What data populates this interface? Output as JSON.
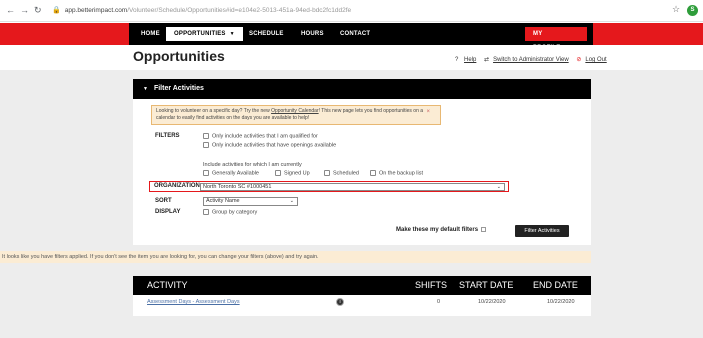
{
  "browser": {
    "url_host": "app.betterimpact.com",
    "url_path": "/Volunteer/Schedule/Opportunities#id=e104e2-5013-451a-94ed-bdc2fc1dd2fe",
    "profile_initial": "S"
  },
  "nav": {
    "items": [
      "HOME",
      "OPPORTUNITIES",
      "SCHEDULE",
      "HOURS",
      "CONTACT"
    ],
    "profile": "MY PROFILE"
  },
  "header": {
    "title": "Opportunities",
    "help": "Help",
    "switch_admin": "Switch to Administrator View",
    "logout": "Log Out"
  },
  "filters": {
    "panel_title": "Filter Activities",
    "notice_text": "Looking to volunteer on a specific day? Try the new ",
    "notice_link": "Opportunity Calendar",
    "notice_text2": "! This new page lets you find opportunities on a calendar to easily find activities on the days you are available to help!",
    "label_filters": "FILTERS",
    "qualified": "Only include activities that I am qualified for",
    "openings": "Only include activities that have openings available",
    "include_label": "Include activities for which I am currently",
    "status_options": [
      "Generally Available",
      "Signed Up",
      "Scheduled",
      "On the backup list"
    ],
    "label_org": "ORGANIZATION",
    "org_value": "North Toronto SC #1000451",
    "label_sort": "SORT",
    "sort_value": "Activity Name",
    "label_display": "DISPLAY",
    "group_by": "Group by category",
    "make_default": "Make these my default filters",
    "filter_button": "Filter Activities"
  },
  "warning": "It looks like you have filters applied. If you don't see the item you are looking for, you can change your filters (above) and try again.",
  "table": {
    "headers": [
      "ACTIVITY",
      "SHIFTS",
      "START DATE",
      "END DATE"
    ],
    "rows": [
      {
        "activity": "Assessment Days - Assessment Days",
        "shifts": "0",
        "start": "10/22/2020",
        "end": "10/22/2020"
      }
    ]
  }
}
